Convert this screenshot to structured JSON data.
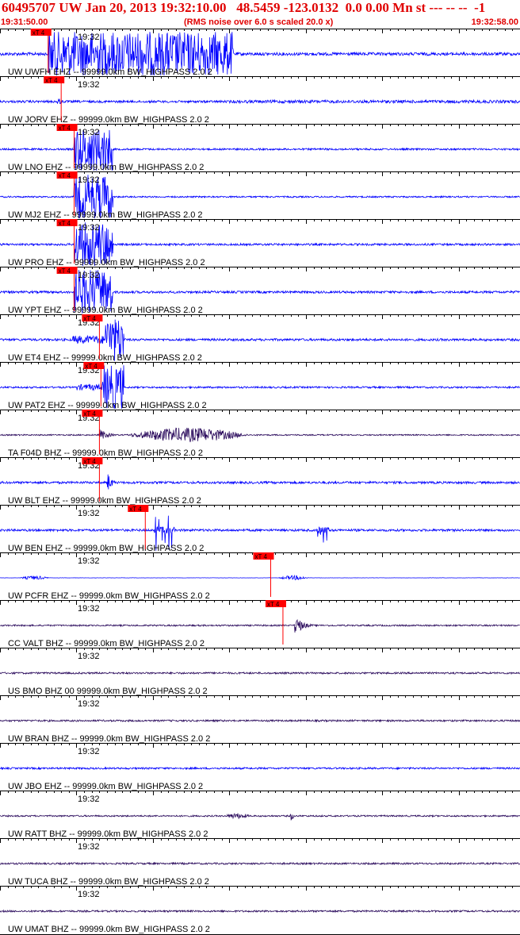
{
  "header": {
    "title": "60495707 UW Jan 20, 2013 19:32:10.00   48.5459 -123.0132  0.0 0.00 Mn st --- -- --  -1",
    "start_time": "19:31:50.00",
    "subtitle": "(RMS noise over 6.0 s scaled 20.0 x)",
    "end_time": "19:32:58.00"
  },
  "colors": {
    "header_text": "#e00000",
    "trace_blue": "#0000ff",
    "trace_purple": "#2a0a5c",
    "pick_marker": "#ff0000",
    "gridline": "#000000",
    "label_text": "#000000"
  },
  "chart_data": {
    "type": "seismogram",
    "x_range_seconds": [
      0,
      68
    ],
    "time_label": "19:32",
    "pick_label": "xT 4",
    "traces": [
      {
        "label": "UW UWFH EHZ -- 99999.0km BW_HIGHPASS  2.0  2",
        "color": "blue",
        "noise": 0.6,
        "pick": 6.3,
        "bursts": [
          {
            "s": 6.3,
            "e": 30.5,
            "a": 4.0,
            "kind": "block"
          }
        ]
      },
      {
        "label": "UW JORV EHZ -- 99999.0km BW_HIGHPASS  2.0  2",
        "color": "blue",
        "noise": 0.45,
        "pick": 8.0,
        "bursts": [
          {
            "s": 7.5,
            "e": 9.5,
            "a": 0.8,
            "kind": "decay"
          },
          {
            "s": 30,
            "e": 68,
            "a": 0.3,
            "kind": "noise"
          }
        ]
      },
      {
        "label": "UW LNO EHZ -- 99999.0km BW_HIGHPASS  2.0  2",
        "color": "blue",
        "noise": 0.35,
        "pick": 9.7,
        "bursts": [
          {
            "s": 9.7,
            "e": 14.8,
            "a": 4.0,
            "kind": "block"
          }
        ]
      },
      {
        "label": "UW MJ2 EHZ -- 99999.0km BW_HIGHPASS  2.0  2",
        "color": "blue",
        "noise": 0.3,
        "pick": 9.7,
        "bursts": [
          {
            "s": 9.7,
            "e": 14.8,
            "a": 4.0,
            "kind": "block"
          }
        ]
      },
      {
        "label": "UW PRO EHZ -- 99999.0km BW_HIGHPASS  2.0  2",
        "color": "blue",
        "noise": 0.4,
        "pick": 9.7,
        "bursts": [
          {
            "s": 9.7,
            "e": 14.8,
            "a": 4.0,
            "kind": "block"
          }
        ]
      },
      {
        "label": "UW YPT EHZ -- 99999.0km BW_HIGHPASS  2.0  2",
        "color": "blue",
        "noise": 0.45,
        "pick": 9.7,
        "bursts": [
          {
            "s": 9.7,
            "e": 14.8,
            "a": 4.0,
            "kind": "block"
          }
        ]
      },
      {
        "label": "UW ET4 EHZ -- 99999.0km BW_HIGHPASS  2.0  2",
        "color": "blue",
        "noise": 0.45,
        "pick": 13.0,
        "bursts": [
          {
            "s": 9.5,
            "e": 13.5,
            "a": 0.8,
            "kind": "noise"
          },
          {
            "s": 13.8,
            "e": 16.2,
            "a": 4.0,
            "kind": "block"
          }
        ]
      },
      {
        "label": "UW PAT2 EHZ -- 99999.0km BW_HIGHPASS  2.0  2",
        "color": "blue",
        "noise": 0.35,
        "pick": 13.2,
        "bursts": [
          {
            "s": 10,
            "e": 13.5,
            "a": 0.6,
            "kind": "noise"
          },
          {
            "s": 13.4,
            "e": 16.2,
            "a": 4.0,
            "kind": "block"
          }
        ]
      },
      {
        "label": "TA F04D BHZ -- 99999.0km BW_HIGHPASS  2.0  2",
        "color": "purple",
        "noise": 0.25,
        "pick": 13.0,
        "bursts": [
          {
            "s": 13,
            "e": 16,
            "a": 1.2,
            "kind": "decay"
          },
          {
            "s": 16,
            "e": 33,
            "a": 1.3,
            "kind": "swell"
          }
        ]
      },
      {
        "label": "UW BLT EHZ -- 99999.0km BW_HIGHPASS  2.0  2",
        "color": "blue",
        "noise": 0.45,
        "pick": 13.0,
        "bursts": [
          {
            "s": 14,
            "e": 15.5,
            "a": 2.2,
            "kind": "decay"
          }
        ]
      },
      {
        "label": "UW BEN EHZ -- 99999.0km BW_HIGHPASS  2.0  2",
        "color": "blue",
        "noise": 0.45,
        "pick": 19.0,
        "bursts": [
          {
            "s": 20,
            "e": 22.8,
            "a": 4.0,
            "kind": "sparse"
          },
          {
            "s": 41.5,
            "e": 43,
            "a": 4.0,
            "kind": "sparse"
          }
        ]
      },
      {
        "label": "UW PCFR EHZ -- 99999.0km BW_HIGHPASS  2.0  2",
        "color": "blue",
        "noise": 0.05,
        "pick": 35.4,
        "bursts": [
          {
            "s": 2.5,
            "e": 6.5,
            "a": 0.35,
            "kind": "swell"
          },
          {
            "s": 36.3,
            "e": 40.5,
            "a": 0.4,
            "kind": "swell"
          }
        ]
      },
      {
        "label": "CC VALT BHZ -- 99999.0km BW_HIGHPASS  2.0  2",
        "color": "purple",
        "noise": 0.3,
        "pick": 37.0,
        "bursts": [
          {
            "s": 38.5,
            "e": 41.5,
            "a": 2.0,
            "kind": "decay"
          }
        ]
      },
      {
        "label": "US BMO BHZ 00 99999.0km BW_HIGHPASS  2.0  2",
        "color": "purple",
        "noise": 0.35,
        "pick": null,
        "bursts": []
      },
      {
        "label": "UW BRAN BHZ -- 99999.0km BW_HIGHPASS  2.0  2",
        "color": "purple",
        "noise": 0.35,
        "pick": null,
        "bursts": []
      },
      {
        "label": "UW JBO EHZ -- 99999.0km BW_HIGHPASS  2.0  2",
        "color": "blue",
        "noise": 0.35,
        "pick": null,
        "bursts": []
      },
      {
        "label": "UW RATT BHZ -- 99999.0km BW_HIGHPASS  2.0  2",
        "color": "purple",
        "noise": 0.3,
        "pick": null,
        "bursts": [
          {
            "s": 29,
            "e": 33,
            "a": 0.5,
            "kind": "swell"
          },
          {
            "s": 38,
            "e": 39,
            "a": 1.1,
            "kind": "decay"
          }
        ]
      },
      {
        "label": "UW TUCA BHZ -- 99999.0km BW_HIGHPASS  2.0  2",
        "color": "purple",
        "noise": 0.35,
        "pick": null,
        "bursts": []
      },
      {
        "label": "UW UMAT BHZ -- 99999.0km BW_HIGHPASS  2.0  2",
        "color": "purple",
        "noise": 0.35,
        "pick": null,
        "bursts": []
      }
    ]
  }
}
